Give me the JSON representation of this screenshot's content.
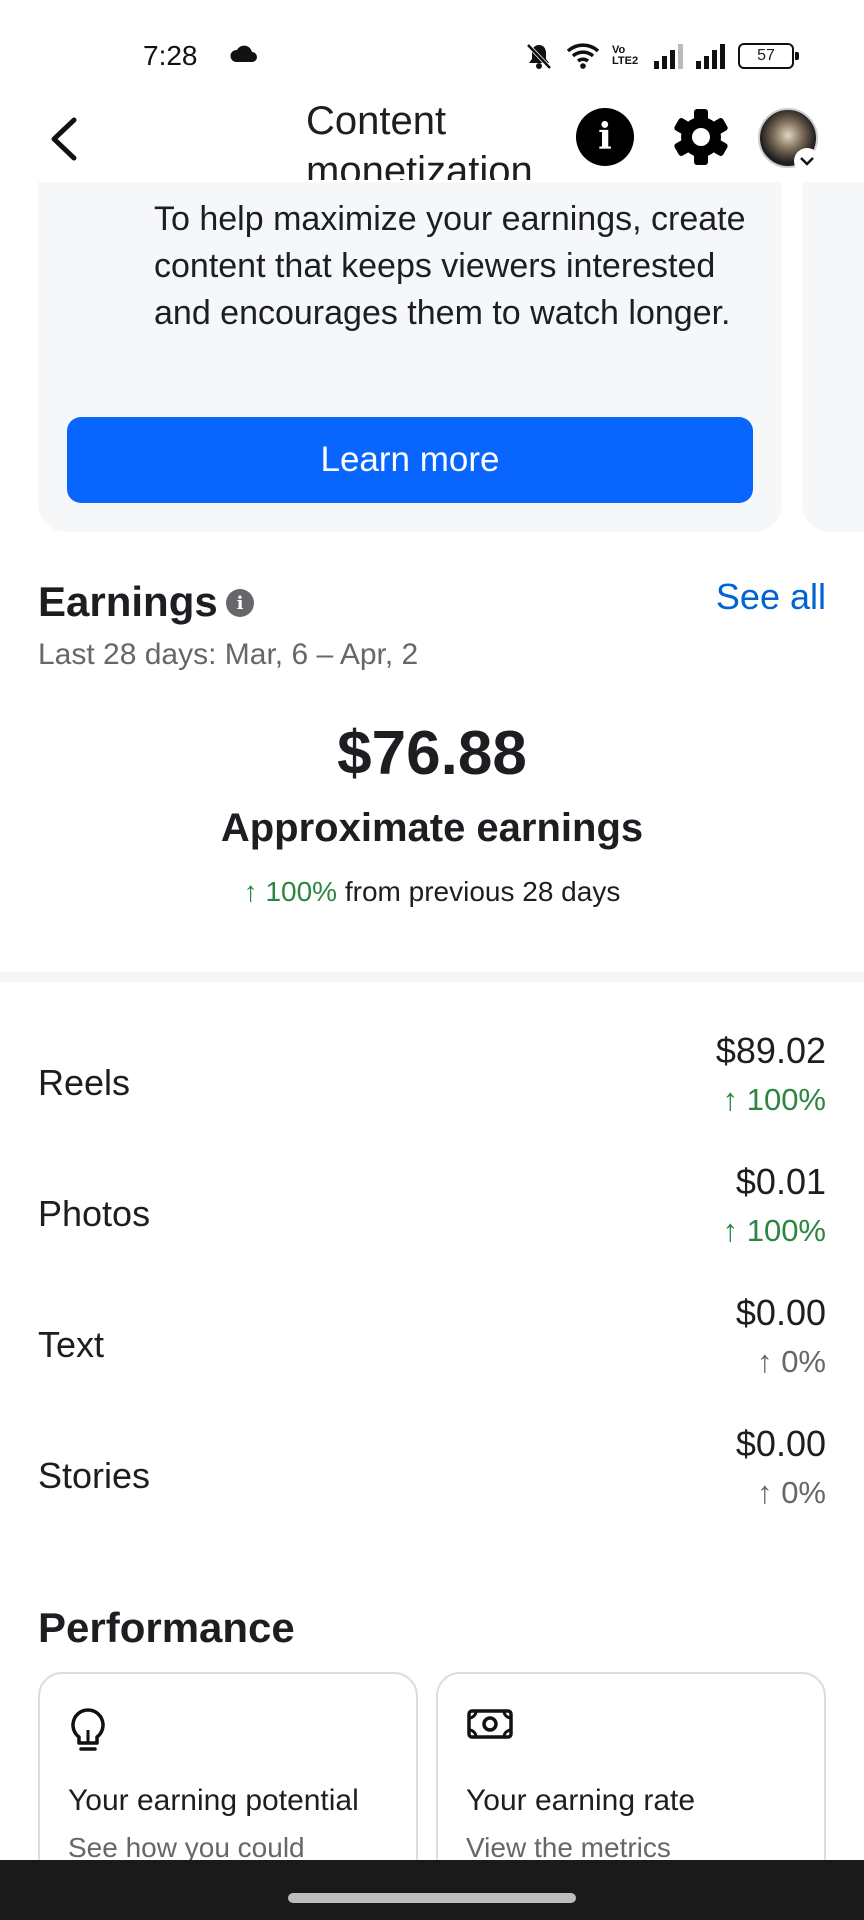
{
  "status_bar": {
    "time": "7:28",
    "network_label": "Vo LTE2",
    "battery": "57"
  },
  "header": {
    "title": "Content monetization"
  },
  "tip_card": {
    "text": "To help maximize your earnings, create content that keeps viewers interested and encourages them to watch longer.",
    "button_label": "Learn more"
  },
  "earnings": {
    "title": "Earnings",
    "see_all_label": "See all",
    "period_label": "Last 28 days:",
    "period_range": "Mar, 6 – Apr, 2",
    "total": "$76.88",
    "total_label": "Approximate earnings",
    "change_arrow": "↑",
    "change_percent": "100%",
    "change_text": "from previous 28 days"
  },
  "breakdown": [
    {
      "label": "Reels",
      "value": "$89.02",
      "change": "↑ 100%",
      "trend": "up"
    },
    {
      "label": "Photos",
      "value": "$0.01",
      "change": "↑ 100%",
      "trend": "up"
    },
    {
      "label": "Text",
      "value": "$0.00",
      "change": "↑ 0%",
      "trend": "flat"
    },
    {
      "label": "Stories",
      "value": "$0.00",
      "change": "↑ 0%",
      "trend": "flat"
    }
  ],
  "performance": {
    "title": "Performance",
    "cards": [
      {
        "icon": "lightbulb-icon",
        "title": "Your earning potential",
        "subtitle": "See how you could"
      },
      {
        "icon": "money-icon",
        "title": "Your earning rate",
        "subtitle": "View the metrics"
      }
    ]
  },
  "colors": {
    "primary_button": "#0866ff",
    "link": "#0064d1",
    "positive": "#2e8540",
    "muted": "#65676b"
  }
}
